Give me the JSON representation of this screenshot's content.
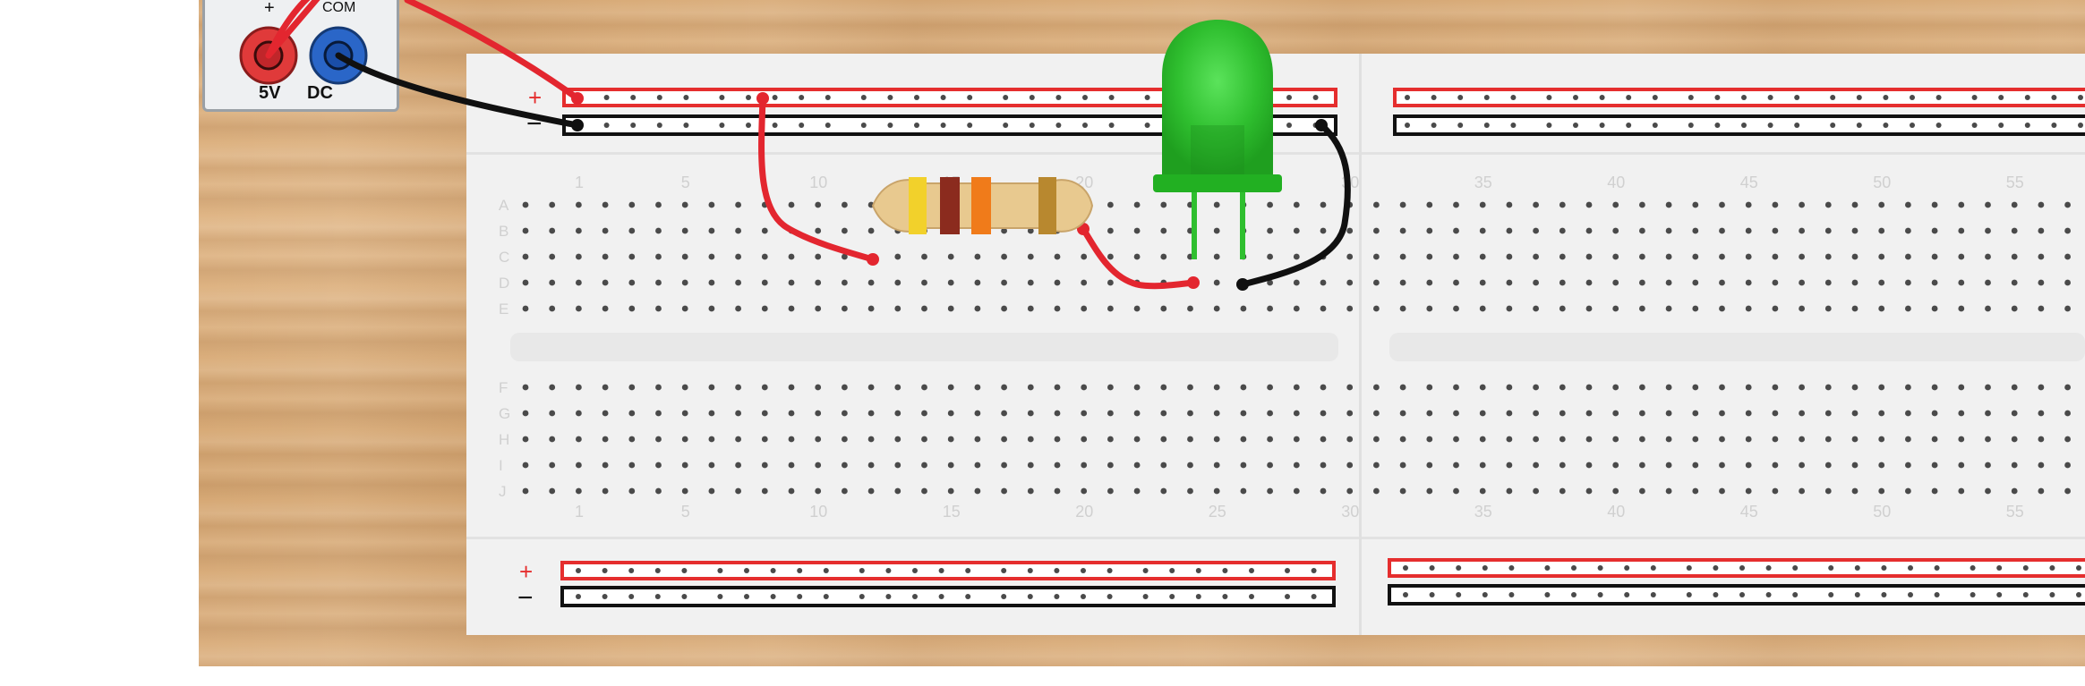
{
  "power_supply": {
    "plus_label": "+",
    "com_label": "COM",
    "voltage_label": "5V",
    "dc_label": "DC",
    "colors": {
      "positive": "#e52e2e",
      "negative": "#1e5bb8"
    },
    "icons": [
      "positive-terminal-icon",
      "com-terminal-icon"
    ]
  },
  "breadboard": {
    "rail_plus_label": "+",
    "rail_minus_label": "−",
    "column_numbers": [
      "1",
      "5",
      "10",
      "15",
      "20",
      "25",
      "30",
      "35",
      "40",
      "45",
      "50",
      "55"
    ],
    "row_letters_top": [
      "A",
      "B",
      "C",
      "D",
      "E"
    ],
    "row_letters_bottom": [
      "F",
      "G",
      "H",
      "I",
      "J"
    ],
    "colors": {
      "rail_plus": "#e52e2e",
      "rail_minus": "#111111"
    }
  },
  "components": {
    "led": {
      "color": "#2fbf2f",
      "icon": "green-led-icon"
    },
    "resistor": {
      "bands": [
        "#f2d12b",
        "#8b2b1e",
        "#f07b1a",
        "#b8882f"
      ],
      "icon": "resistor-icon"
    }
  },
  "wires": {
    "red": "#e3262f",
    "black": "#101010"
  }
}
